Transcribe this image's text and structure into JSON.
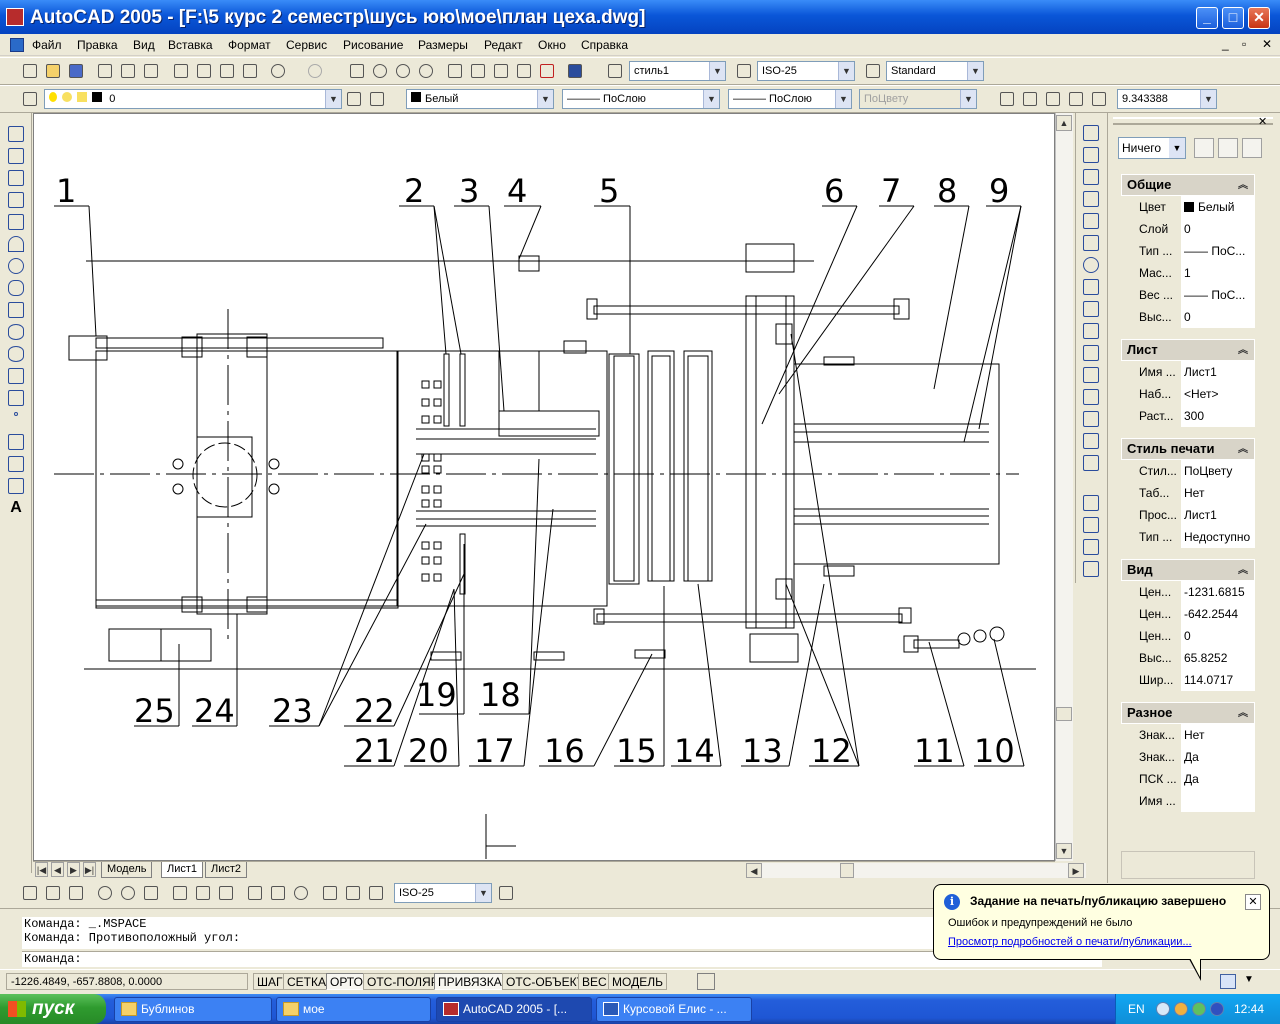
{
  "window": {
    "title": "AutoCAD 2005 - [F:\\5 курс 2 семестр\\шусь юю\\мое\\план цеха.dwg]",
    "min_label": "_",
    "max_label": "□",
    "close_label": "✕"
  },
  "menu": {
    "items": [
      "Файл",
      "Правка",
      "Вид",
      "Вставка",
      "Формат",
      "Сервис",
      "Рисование",
      "Размеры",
      "Редакт",
      "Окно",
      "Справка"
    ],
    "doc_controls": [
      "_",
      "▫",
      "✕"
    ]
  },
  "toolbar_standard": {
    "text_style": "стиль1",
    "dim_style": "ISO-25",
    "table_style": "Standard"
  },
  "toolbar_layers": {
    "layer": "0",
    "color": "Белый",
    "linetype": "——— ПоСлою",
    "lineweight": "——— ПоСлою",
    "plotstyle": "ПоЦвету",
    "zoom_value": "9.343388"
  },
  "drawing": {
    "callouts_top": [
      "1",
      "2",
      "3",
      "4",
      "5",
      "6",
      "7",
      "8",
      "9"
    ],
    "callouts_bottom": [
      "25",
      "24",
      "23",
      "22",
      "19",
      "18",
      "21",
      "20",
      "17",
      "16",
      "15",
      "14",
      "13",
      "12",
      "11",
      "10"
    ]
  },
  "layout_tabs": {
    "tabs": [
      "Модель",
      "Лист1",
      "Лист2"
    ],
    "active": "Лист1"
  },
  "dim_toolbar": {
    "dim_style": "ISO-25"
  },
  "properties": {
    "selection": "Ничего",
    "sections": [
      {
        "title": "Общие",
        "rows": [
          {
            "key": "Цвет",
            "value": "Белый"
          },
          {
            "key": "Слой",
            "value": "0"
          },
          {
            "key": "Тип ...",
            "value": "—— ПоС..."
          },
          {
            "key": "Мас...",
            "value": "1"
          },
          {
            "key": "Вес ...",
            "value": "—— ПоС..."
          },
          {
            "key": "Выс...",
            "value": "0"
          }
        ]
      },
      {
        "title": "Лист",
        "rows": [
          {
            "key": "Имя ...",
            "value": "Лист1"
          },
          {
            "key": "Наб...",
            "value": "<Нет>"
          },
          {
            "key": "Раст...",
            "value": "300"
          }
        ]
      },
      {
        "title": "Стиль печати",
        "rows": [
          {
            "key": "Стил...",
            "value": "ПоЦвету"
          },
          {
            "key": "Таб...",
            "value": "Нет"
          },
          {
            "key": "Прос...",
            "value": "Лист1"
          },
          {
            "key": "Тип ...",
            "value": "Недоступно"
          }
        ]
      },
      {
        "title": "Вид",
        "rows": [
          {
            "key": "Цен...",
            "value": "-1231.6815"
          },
          {
            "key": "Цен...",
            "value": "-642.2544"
          },
          {
            "key": "Цен...",
            "value": "0"
          },
          {
            "key": "Выс...",
            "value": "65.8252"
          },
          {
            "key": "Шир...",
            "value": "114.0717"
          }
        ]
      },
      {
        "title": "Разное",
        "rows": [
          {
            "key": "Знак...",
            "value": "Нет"
          },
          {
            "key": "Знак...",
            "value": "Да"
          },
          {
            "key": "ПСК ...",
            "value": "Да"
          },
          {
            "key": "Имя ...",
            "value": ""
          }
        ]
      }
    ]
  },
  "command": {
    "history_line1": "Команда: _.MSPACE",
    "history_line2": "Команда: Противоположный угол:",
    "prompt": "Команда:"
  },
  "status": {
    "coords": "-1226.4849, -657.8808, 0.0000",
    "buttons": [
      "ШАГ",
      "СЕТКА",
      "ОРТО",
      "ОТС-ПОЛЯР",
      "ПРИВЯЗКА",
      "ОТС-ОБЪЕКТ",
      "ВЕС",
      "МОДЕЛЬ"
    ]
  },
  "balloon": {
    "title": "Задание на печать/публикацию завершено",
    "message": "Ошибок и предупреждений не было",
    "link": "Просмотр подробностей о печати/публикации..."
  },
  "taskbar": {
    "start": "пуск",
    "tasks": [
      "Бублинов",
      "мое",
      "AutoCAD 2005 - [...",
      "Курсовой Елис - ..."
    ],
    "lang": "EN",
    "time": "12:44"
  }
}
